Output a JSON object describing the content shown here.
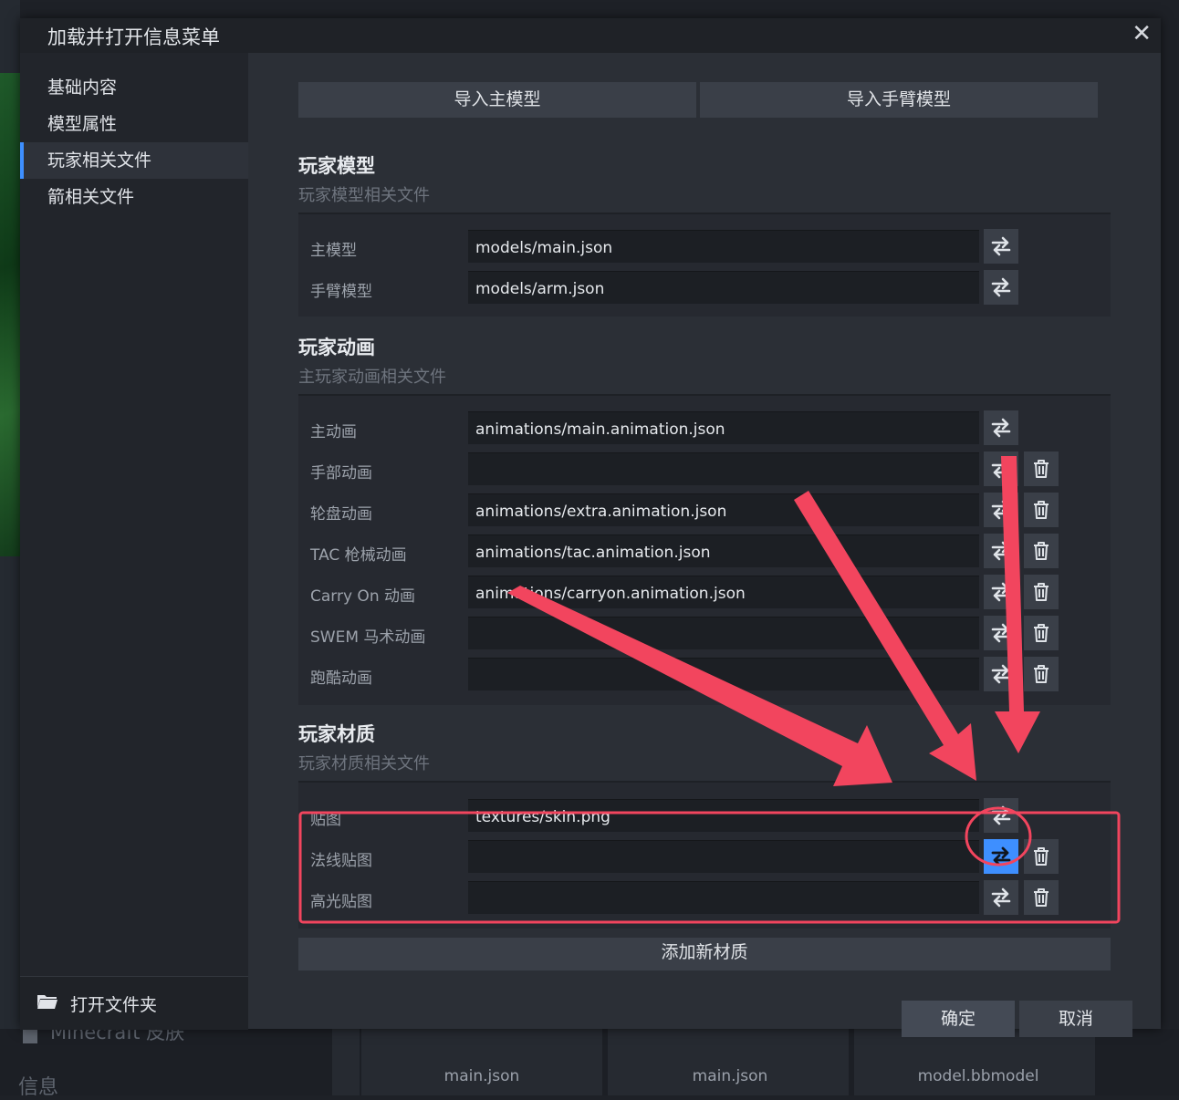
{
  "dialog": {
    "title": "加载并打开信息菜单",
    "close": "✕"
  },
  "sidebar": {
    "items": [
      {
        "label": "基础内容"
      },
      {
        "label": "模型属性"
      },
      {
        "label": "玩家相关文件"
      },
      {
        "label": "箭相关文件"
      }
    ],
    "footer_label": "打开文件夹"
  },
  "actions": {
    "import_main": "导入主模型",
    "import_arm": "导入手臂模型",
    "add_texture": "添加新材质",
    "confirm": "确定",
    "cancel": "取消"
  },
  "model_section": {
    "title": "玩家模型",
    "subtitle": "玩家模型相关文件",
    "rows": [
      {
        "label": "主模型",
        "value": "models/main.json"
      },
      {
        "label": "手臂模型",
        "value": "models/arm.json"
      }
    ]
  },
  "animation_section": {
    "title": "玩家动画",
    "subtitle": "主玩家动画相关文件",
    "rows": [
      {
        "label": "主动画",
        "value": "animations/main.animation.json"
      },
      {
        "label": "手部动画",
        "value": ""
      },
      {
        "label": "轮盘动画",
        "value": "animations/extra.animation.json"
      },
      {
        "label": "TAC 枪械动画",
        "value": "animations/tac.animation.json"
      },
      {
        "label": "Carry On 动画",
        "value": "animations/carryon.animation.json"
      },
      {
        "label": "SWEM 马术动画",
        "value": ""
      },
      {
        "label": "跑酷动画",
        "value": ""
      }
    ]
  },
  "texture_section": {
    "title": "玩家材质",
    "subtitle": "玩家材质相关文件",
    "rows": [
      {
        "label": "贴图",
        "value": "textures/skin.png"
      },
      {
        "label": "法线贴图",
        "value": ""
      },
      {
        "label": "高光贴图",
        "value": ""
      }
    ]
  },
  "background": {
    "skin_label": "Minecraft 皮肤",
    "info_label": "信息",
    "files": [
      "main.json",
      "main.json",
      "model.bbmodel"
    ]
  },
  "colors": {
    "accent": "#3e8fff",
    "annotation": "#f2455e"
  }
}
